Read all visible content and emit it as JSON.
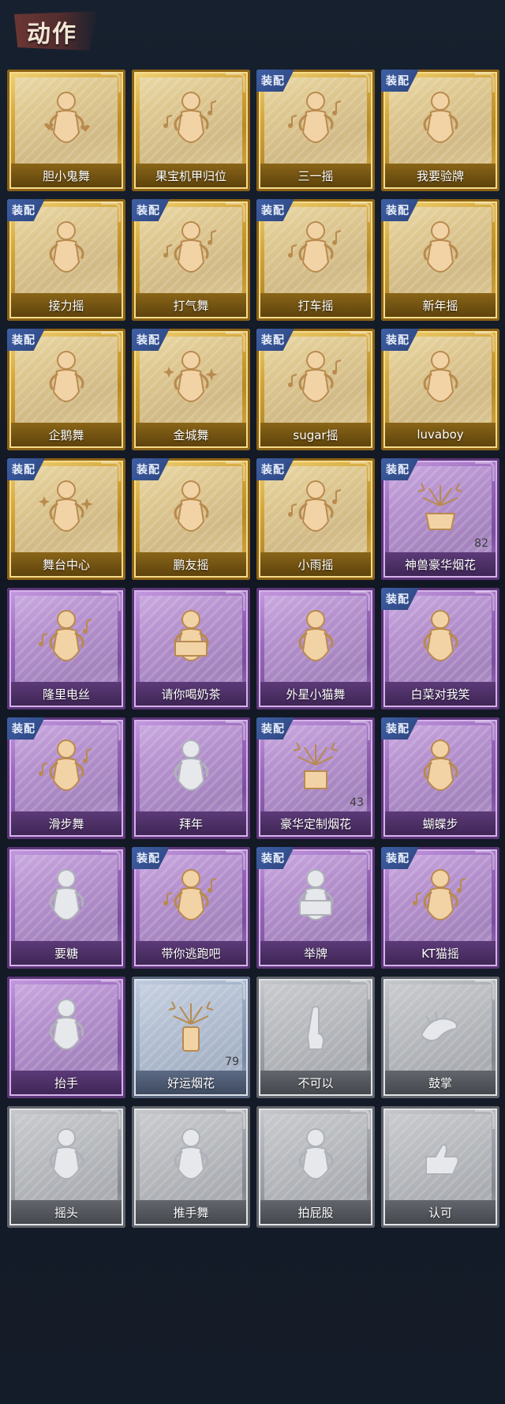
{
  "header": {
    "title": "动作"
  },
  "equipped_label": "装配",
  "colors": {
    "gold": "#d6a93e",
    "purple": "#9a69bc",
    "blue": "#99a9c0",
    "gray": "#a3a6ac",
    "badge": "#3e5fa6",
    "background": "#141a26"
  },
  "actions": [
    {
      "label": "胆小鬼舞",
      "rarity": "gold",
      "equipped": false,
      "icon": "dance-figure-hearts-icon"
    },
    {
      "label": "果宝机甲归位",
      "rarity": "gold",
      "equipped": false,
      "icon": "dance-figure-music-icon"
    },
    {
      "label": "三一摇",
      "rarity": "gold",
      "equipped": true,
      "icon": "dance-figure-music-icon"
    },
    {
      "label": "我要验牌",
      "rarity": "gold",
      "equipped": true,
      "icon": "dance-figure-icon"
    },
    {
      "label": "接力摇",
      "rarity": "gold",
      "equipped": true,
      "icon": "dance-figure-icon"
    },
    {
      "label": "打气舞",
      "rarity": "gold",
      "equipped": true,
      "icon": "dance-figure-music-icon"
    },
    {
      "label": "打车摇",
      "rarity": "gold",
      "equipped": true,
      "icon": "dance-figure-music-icon"
    },
    {
      "label": "新年摇",
      "rarity": "gold",
      "equipped": true,
      "icon": "dance-figure-icon"
    },
    {
      "label": "企鹅舞",
      "rarity": "gold",
      "equipped": true,
      "icon": "dance-figure-icon"
    },
    {
      "label": "金城舞",
      "rarity": "gold",
      "equipped": true,
      "icon": "dance-figure-sparkle-icon"
    },
    {
      "label": "sugar摇",
      "rarity": "gold",
      "equipped": true,
      "icon": "dance-figure-music-icon"
    },
    {
      "label": "luvaboy",
      "rarity": "gold",
      "equipped": true,
      "icon": "dance-figure-icon"
    },
    {
      "label": "舞台中心",
      "rarity": "gold",
      "equipped": true,
      "icon": "dance-figure-sparkle-icon"
    },
    {
      "label": "鹏友摇",
      "rarity": "gold",
      "equipped": true,
      "icon": "dance-figure-icon"
    },
    {
      "label": "小雨摇",
      "rarity": "gold",
      "equipped": true,
      "icon": "dance-figure-music-icon"
    },
    {
      "label": "神兽豪华烟花",
      "rarity": "purple",
      "equipped": true,
      "icon": "fireworks-pot-icon",
      "count": "82"
    },
    {
      "label": "隆里电丝",
      "rarity": "purple",
      "equipped": false,
      "icon": "dance-figure-music-icon"
    },
    {
      "label": "请你喝奶茶",
      "rarity": "purple",
      "equipped": false,
      "icon": "figure-with-sign-icon"
    },
    {
      "label": "外星小猫舞",
      "rarity": "purple",
      "equipped": false,
      "icon": "dance-figure-icon"
    },
    {
      "label": "白菜对我笑",
      "rarity": "purple",
      "equipped": true,
      "icon": "dance-figure-icon"
    },
    {
      "label": "滑步舞",
      "rarity": "purple",
      "equipped": true,
      "icon": "dance-figure-music-icon"
    },
    {
      "label": "拜年",
      "rarity": "purple",
      "equipped": false,
      "icon": "bow-figure-icon",
      "faded": true
    },
    {
      "label": "豪华定制烟花",
      "rarity": "purple",
      "equipped": true,
      "icon": "fireworks-box-icon",
      "count": "43"
    },
    {
      "label": "蝴蝶步",
      "rarity": "purple",
      "equipped": true,
      "icon": "dance-figure-icon"
    },
    {
      "label": "要糖",
      "rarity": "purple",
      "equipped": false,
      "icon": "reach-figure-icon",
      "faded": true
    },
    {
      "label": "带你逃跑吧",
      "rarity": "purple",
      "equipped": true,
      "icon": "dance-figure-music-icon"
    },
    {
      "label": "举牌",
      "rarity": "purple",
      "equipped": true,
      "icon": "figure-with-sign-icon",
      "faded": true
    },
    {
      "label": "KT猫摇",
      "rarity": "purple",
      "equipped": true,
      "icon": "dance-figure-music-icon"
    },
    {
      "label": "抬手",
      "rarity": "purple",
      "equipped": false,
      "icon": "raise-hand-figure-icon",
      "faded": true
    },
    {
      "label": "好运烟花",
      "rarity": "blue",
      "equipped": false,
      "icon": "firework-can-icon",
      "count": "79"
    },
    {
      "label": "不可以",
      "rarity": "gray",
      "equipped": false,
      "icon": "finger-wag-icon",
      "faded": true
    },
    {
      "label": "鼓掌",
      "rarity": "gray",
      "equipped": false,
      "icon": "clap-hands-icon",
      "faded": true
    },
    {
      "label": "摇头",
      "rarity": "gray",
      "equipped": false,
      "icon": "shake-head-figure-icon",
      "faded": true
    },
    {
      "label": "推手舞",
      "rarity": "gray",
      "equipped": false,
      "icon": "push-hands-figure-icon",
      "faded": true
    },
    {
      "label": "拍屁股",
      "rarity": "gray",
      "equipped": false,
      "icon": "slap-figure-icon",
      "faded": true
    },
    {
      "label": "认可",
      "rarity": "gray",
      "equipped": false,
      "icon": "thumbs-up-icon",
      "faded": true
    }
  ]
}
